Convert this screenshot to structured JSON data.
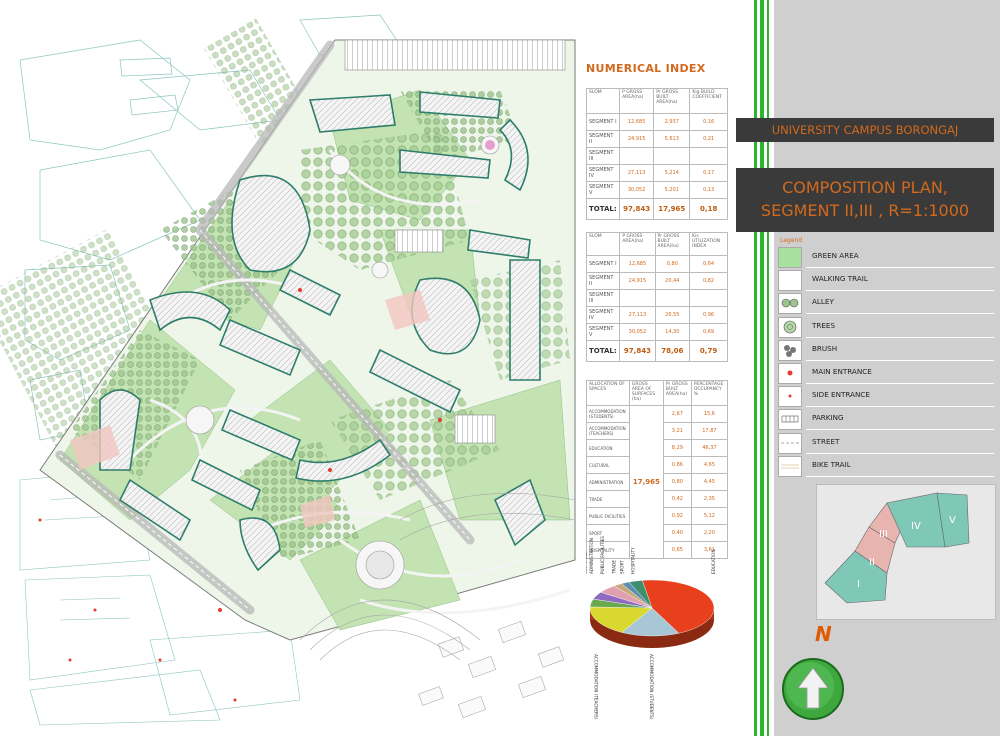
{
  "header": {
    "project_title": "UNIVERSITY CAMPUS BORONGAJ",
    "plan_title_line1": "COMPOSITION PLAN,",
    "plan_title_line2": "SEGMENT II,III , R=1:1000"
  },
  "numerical_index": {
    "title": "NUMERICAL INDEX",
    "table1": {
      "headers": [
        "SLOM",
        "P GROSS AREA(ha)",
        "Pr GROSS BUILT AREA(ha)",
        "Kig BUILD COEFFICIENT"
      ],
      "rows": [
        [
          "SEGMENT I",
          "12,685",
          "2,937",
          "0,16"
        ],
        [
          "SEGMENT II",
          "24,915",
          "5,613",
          "0,21"
        ],
        [
          "SEGMENT III",
          "",
          "",
          ""
        ],
        [
          "SEGMENT IV",
          "27,113",
          "5,214",
          "0,17"
        ],
        [
          "SEGMENT V",
          "30,052",
          "5,201",
          "0,13"
        ]
      ],
      "total": [
        "TOTAL:",
        "97,843",
        "17,965",
        "0,18"
      ]
    },
    "table2": {
      "headers": [
        "SLOM",
        "P GROSS AREA(ha)",
        "Pr GROSS BUILT AREA(ha)",
        "Kis UTILIZATION INDEX"
      ],
      "rows": [
        [
          "SEGMENT I",
          "12,685",
          "0,80",
          "0,64"
        ],
        [
          "SEGMENT II",
          "24,915",
          "20,44",
          "0,82"
        ],
        [
          "SEGMENT III",
          "",
          "",
          ""
        ],
        [
          "SEGMENT IV",
          "27,113",
          "26,55",
          "0,96"
        ],
        [
          "SEGMENT V",
          "30,052",
          "14,30",
          "0,69"
        ]
      ],
      "total": [
        "TOTAL:",
        "97,843",
        "78,06",
        "0,79"
      ]
    },
    "table3": {
      "headers": [
        "ALLOCATION OF SPACES",
        "GROSS AREA OF SURFACES (ha)",
        "Pr GROSS BUILT AREA(ha)",
        "PERCENTAGE OCCUPANCY %"
      ],
      "merged_value": "17,965",
      "rows": [
        [
          "ACCOMMODATION (STUDENTS)",
          "2,67",
          "15,6"
        ],
        [
          "ACCOMMODATION (TEACHERS)",
          "3,21",
          "17,87"
        ],
        [
          "EDUCATION",
          "8,29",
          "46,37"
        ],
        [
          "CULTURAL",
          "0,86",
          "4,65"
        ],
        [
          "ADMINISTRATION",
          "0,80",
          "4,45"
        ],
        [
          "TRADE",
          "0,42",
          "2,35"
        ],
        [
          "PUBLIC FACILITIES",
          "0,92",
          "5,12"
        ],
        [
          "SPORT",
          "0,40",
          "2,20"
        ],
        [
          "HOSPITALITY",
          "0,65",
          "3,61"
        ]
      ]
    }
  },
  "chart_data": {
    "type": "pie",
    "title": "",
    "categories": [
      "EDUCATION",
      "ACCOMMODATION (STUDENTS)",
      "ACCOMMODATION (TEACHERS)",
      "CULTURAL",
      "ADMINISTRATION",
      "PUBLIC FACILITIES",
      "TRADE",
      "SPORT",
      "HOSPITALITY"
    ],
    "values": [
      46.37,
      15.6,
      17.87,
      4.65,
      4.45,
      5.12,
      2.35,
      2.2,
      3.61
    ],
    "colors": [
      "#e8401c",
      "#a7c6d6",
      "#d8d830",
      "#6aa84f",
      "#8e6bbf",
      "#e0a0b0",
      "#c8a878",
      "#5a8fb0",
      "#3d8f6e"
    ]
  },
  "legend": {
    "title": "Legend",
    "items": [
      {
        "label": "GREEN AREA",
        "swatch": "#a8e0a0"
      },
      {
        "label": "WALKING TRAIL",
        "swatch": "#ffffff"
      },
      {
        "label": "ALLEY",
        "swatch": "#ffffff"
      },
      {
        "label": "TREES",
        "swatch": "#ffffff"
      },
      {
        "label": "BRUSH",
        "swatch": "#ffffff"
      },
      {
        "label": "MAIN ENTRANCE",
        "swatch": "#ffffff"
      },
      {
        "label": "SIDE ENTRANCE",
        "swatch": "#ffffff"
      },
      {
        "label": "PARKING",
        "swatch": "#ffffff"
      },
      {
        "label": "STREET",
        "swatch": "#ffffff"
      },
      {
        "label": "BIKE TRAIL",
        "swatch": "#ffffff"
      }
    ]
  },
  "key_map": {
    "segments": [
      "I",
      "II",
      "III",
      "IV",
      "V"
    ]
  },
  "north_arrow": {
    "label": "N"
  },
  "colors": {
    "accent": "#d2691e",
    "green_stripe": "#2db52d",
    "title_band": "#3a3a3a",
    "building_teal": "#2e7d6a",
    "green_area": "#b8dfa8"
  }
}
